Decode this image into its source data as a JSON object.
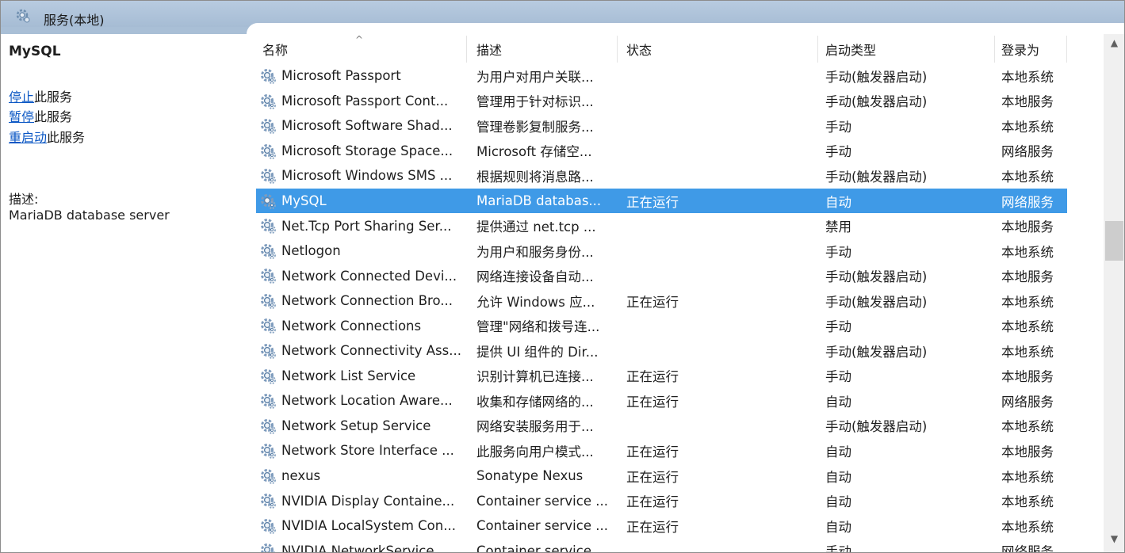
{
  "window": {
    "title": "服务(本地)"
  },
  "left": {
    "service_name": "MySQL",
    "actions": [
      {
        "link": "停止",
        "rest": "此服务"
      },
      {
        "link": "暂停",
        "rest": "此服务"
      },
      {
        "link": "重启动",
        "rest": "此服务"
      }
    ],
    "desc_label": "描述:",
    "desc_text": "MariaDB database server"
  },
  "columns": [
    "名称",
    "描述",
    "状态",
    "启动类型",
    "登录为"
  ],
  "sort_indicator": "^",
  "rows": [
    {
      "name": "Microsoft Passport",
      "desc": "为用户对用户关联...",
      "status": "",
      "startup": "手动(触发器启动)",
      "logon": "本地系统"
    },
    {
      "name": "Microsoft Passport Cont...",
      "desc": "管理用于针对标识...",
      "status": "",
      "startup": "手动(触发器启动)",
      "logon": "本地服务"
    },
    {
      "name": "Microsoft Software Shad...",
      "desc": "管理卷影复制服务...",
      "status": "",
      "startup": "手动",
      "logon": "本地系统"
    },
    {
      "name": "Microsoft Storage Space...",
      "desc": "Microsoft 存储空...",
      "status": "",
      "startup": "手动",
      "logon": "网络服务"
    },
    {
      "name": "Microsoft Windows SMS ...",
      "desc": "根据规则将消息路...",
      "status": "",
      "startup": "手动(触发器启动)",
      "logon": "本地系统"
    },
    {
      "name": "MySQL",
      "desc": "MariaDB databas...",
      "status": "正在运行",
      "startup": "自动",
      "logon": "网络服务",
      "selected": true
    },
    {
      "name": "Net.Tcp Port Sharing Ser...",
      "desc": "提供通过 net.tcp ...",
      "status": "",
      "startup": "禁用",
      "logon": "本地服务"
    },
    {
      "name": "Netlogon",
      "desc": "为用户和服务身份...",
      "status": "",
      "startup": "手动",
      "logon": "本地系统"
    },
    {
      "name": "Network Connected Devi...",
      "desc": "网络连接设备自动...",
      "status": "",
      "startup": "手动(触发器启动)",
      "logon": "本地服务"
    },
    {
      "name": "Network Connection Bro...",
      "desc": "允许 Windows 应...",
      "status": "正在运行",
      "startup": "手动(触发器启动)",
      "logon": "本地系统"
    },
    {
      "name": "Network Connections",
      "desc": "管理\"网络和拨号连...",
      "status": "",
      "startup": "手动",
      "logon": "本地系统"
    },
    {
      "name": "Network Connectivity Ass...",
      "desc": "提供 UI 组件的 Dir...",
      "status": "",
      "startup": "手动(触发器启动)",
      "logon": "本地系统"
    },
    {
      "name": "Network List Service",
      "desc": "识别计算机已连接...",
      "status": "正在运行",
      "startup": "手动",
      "logon": "本地服务"
    },
    {
      "name": "Network Location Aware...",
      "desc": "收集和存储网络的...",
      "status": "正在运行",
      "startup": "自动",
      "logon": "网络服务"
    },
    {
      "name": "Network Setup Service",
      "desc": "网络安装服务用于...",
      "status": "",
      "startup": "手动(触发器启动)",
      "logon": "本地系统"
    },
    {
      "name": "Network Store Interface ...",
      "desc": "此服务向用户模式...",
      "status": "正在运行",
      "startup": "自动",
      "logon": "本地服务"
    },
    {
      "name": "nexus",
      "desc": "Sonatype Nexus",
      "status": "正在运行",
      "startup": "自动",
      "logon": "本地系统"
    },
    {
      "name": "NVIDIA Display Containe...",
      "desc": "Container service ...",
      "status": "正在运行",
      "startup": "自动",
      "logon": "本地系统"
    },
    {
      "name": "NVIDIA LocalSystem Con...",
      "desc": "Container service ...",
      "status": "正在运行",
      "startup": "自动",
      "logon": "本地系统"
    },
    {
      "name": "NVIDIA NetworkService ...",
      "desc": "Container service ...",
      "status": "",
      "startup": "手动",
      "logon": "网络服务"
    }
  ]
}
